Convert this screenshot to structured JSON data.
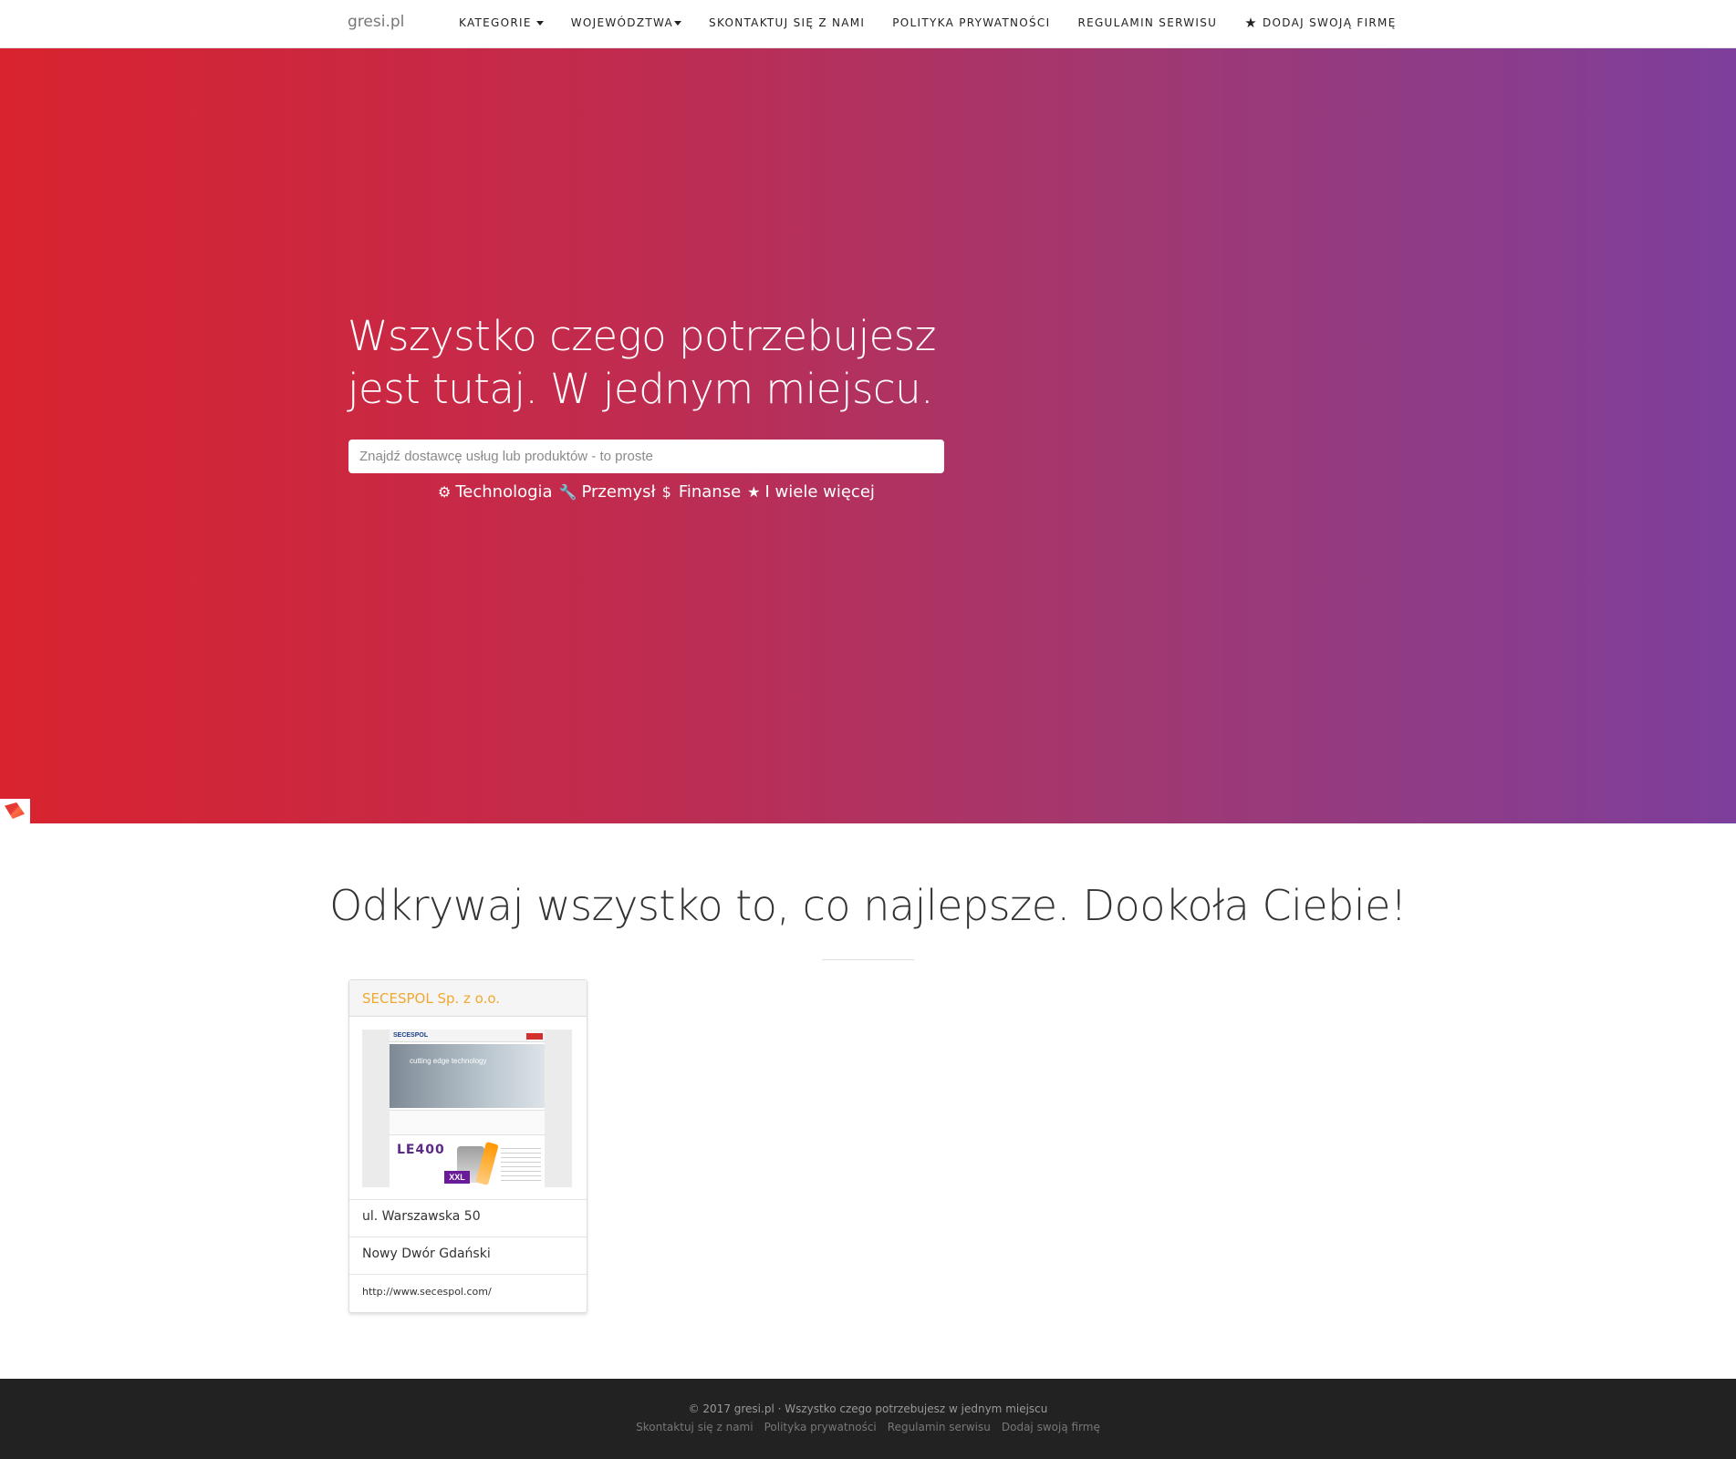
{
  "navbar": {
    "brand": "gresi.pl",
    "items": [
      {
        "label": "Kategorie",
        "dropdown": true
      },
      {
        "label": "Województwa",
        "dropdown": true
      },
      {
        "label": "Skontaktuj się z nami"
      },
      {
        "label": "Polityka prywatności"
      },
      {
        "label": "Regulamin serwisu"
      },
      {
        "label": "Dodaj swoją firmę",
        "icon": "star-icon"
      }
    ]
  },
  "hero": {
    "headline": "Wszystko czego potrzebujesz jest tutaj. W jednym miejscu.",
    "search_placeholder": "Znajdź dostawcę usług lub produktów - to proste",
    "tags": [
      {
        "label": "Technologia",
        "icon": "gear-icon"
      },
      {
        "label": "Przemysł",
        "icon": "wrench-icon"
      },
      {
        "label": "Finanse",
        "icon": "dollar-icon"
      },
      {
        "label": "I wiele więcej",
        "icon": "star-icon"
      }
    ],
    "gradient": {
      "start": "#d9232f",
      "end": "#7d3f9c"
    }
  },
  "discover": {
    "title": "Odkrywaj wszystko to, co najlepsze. Dookoła Ciebie!"
  },
  "companies": [
    {
      "name": "SECESPOL Sp. z o.o.",
      "street": "ul. Warszawska 50",
      "city": "Nowy Dwór Gdański",
      "website": "http://www.secespol.com/",
      "thumbnail_texts": {
        "logo": "SECESPOL",
        "banner": "cutting edge technology",
        "product": "LE400",
        "badge": "XXL"
      }
    }
  ],
  "footer": {
    "copyright": "© 2017 gresi.pl · Wszystko czego potrzebujesz w jednym miejscu",
    "links": [
      "Skontaktuj się z nami",
      "Polityka prywatności",
      "Regulamin serwisu",
      "Dodaj swoją firmę"
    ]
  },
  "colors": {
    "accent": "#f0a830",
    "footer_bg": "#222222"
  }
}
